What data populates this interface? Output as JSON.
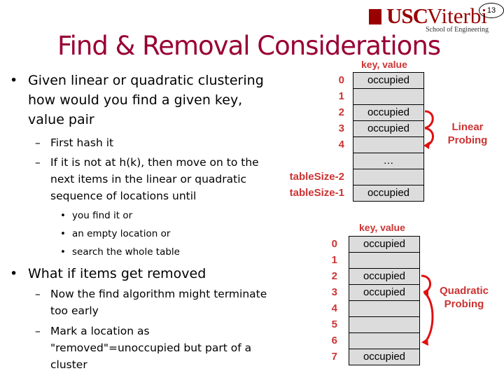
{
  "header": {
    "logo_primary": "USC",
    "logo_secondary": "Viterbi",
    "logo_subtitle": "School of Engineering",
    "page_number": "13"
  },
  "title": "Find & Removal Considerations",
  "bullets": [
    {
      "text": "Given linear or quadratic clustering how would you find a given key, value pair",
      "lines": [
        "Given linear or quadratic clustering",
        "how would you find a given key,",
        "value pair"
      ],
      "children": [
        {
          "text": "First hash it",
          "lines": [
            "First hash it"
          ]
        },
        {
          "text": "If it is not at h(k), then move on to the next items in the linear or quadratic sequence of locations until",
          "lines": [
            "If it is not at h(k), then move on to the",
            "next items in the linear or quadratic",
            "sequence of locations until"
          ],
          "children": [
            "you find it or",
            "an empty location or",
            "search the whole table"
          ]
        }
      ]
    },
    {
      "text": "What if items get removed",
      "lines": [
        "What if items get removed"
      ],
      "children": [
        {
          "text": "Now the find algorithm might terminate too early",
          "lines": [
            "Now the find algorithm might terminate",
            "too early"
          ]
        },
        {
          "text": "Mark a location as \"removed\"=unoccupied but part of a cluster",
          "lines": [
            "Mark a location as",
            "\"removed\"=unoccupied but part of a",
            "cluster"
          ]
        }
      ]
    }
  ],
  "linear_table": {
    "header": "key, value",
    "indices": [
      "0",
      "1",
      "2",
      "3",
      "4",
      "",
      "tableSize-2",
      "tableSize-1"
    ],
    "cells": [
      "occupied",
      "",
      "occupied",
      "occupied",
      "",
      "…",
      "",
      "occupied"
    ],
    "label": [
      "Linear",
      "Probing"
    ]
  },
  "quadratic_table": {
    "header": "key, value",
    "indices": [
      "0",
      "1",
      "2",
      "3",
      "4",
      "5",
      "6",
      "7"
    ],
    "cells": [
      "occupied",
      "",
      "occupied",
      "occupied",
      "",
      "",
      "",
      "occupied"
    ],
    "label": [
      "Quadratic",
      "Probing"
    ]
  },
  "colors": {
    "title": "#990033",
    "accent": "#cc3333",
    "arrow": "#e01010",
    "cell_fill": "#dcdcdc",
    "logo": "#990000"
  }
}
